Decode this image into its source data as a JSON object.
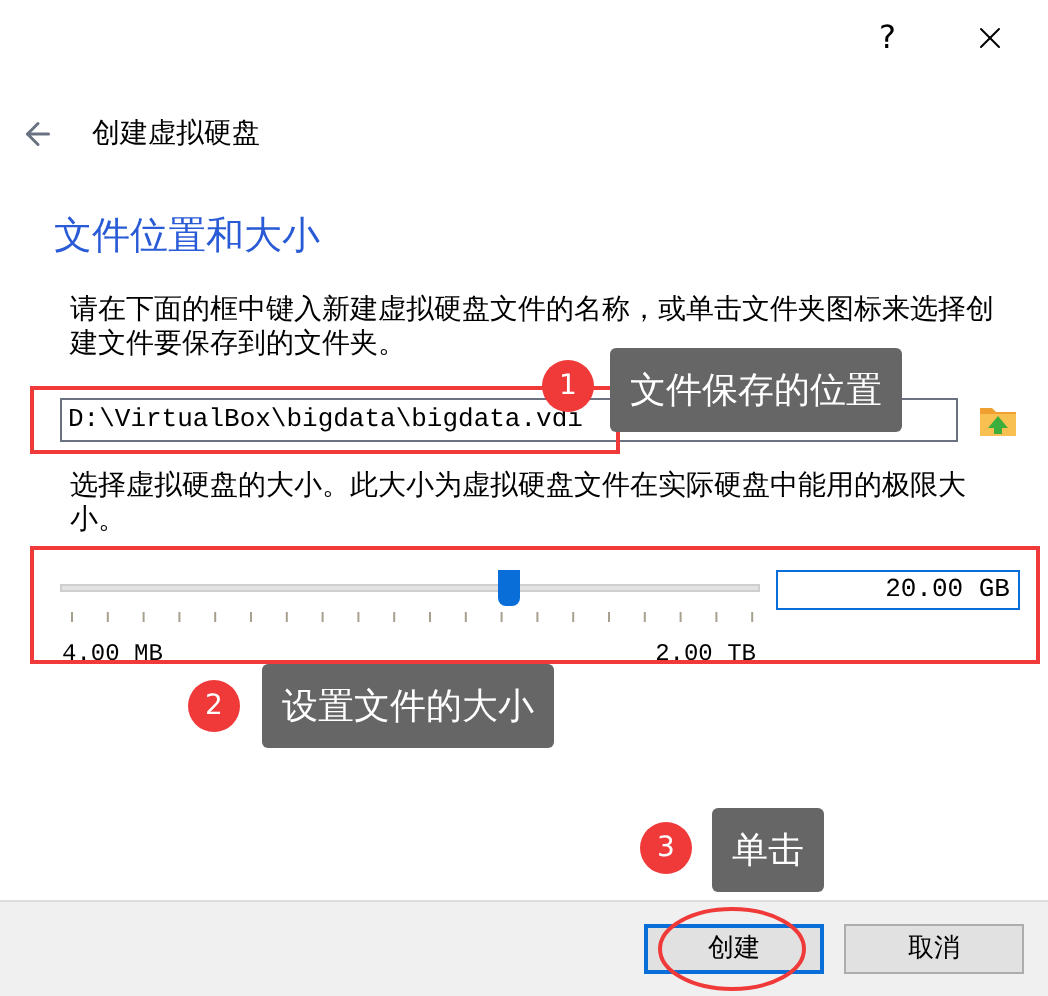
{
  "window": {
    "help": "?"
  },
  "header": {
    "title": "创建虚拟硬盘"
  },
  "section_title": "文件位置和大小",
  "location": {
    "description": "请在下面的框中键入新建虚拟硬盘文件的名称，或单击文件夹图标来选择创建文件要保存到的文件夹。",
    "value": "D:\\VirtualBox\\bigdata\\bigdata.vdi"
  },
  "size": {
    "description": "选择虚拟硬盘的大小。此大小为虚拟硬盘文件在实际硬盘中能用的极限大小。",
    "level": 0.64,
    "value": "20.00 GB",
    "min_label": "4.00 MB",
    "max_label": "2.00 TB"
  },
  "buttons": [
    {
      "label": "创建",
      "default": true
    },
    {
      "label": "取消",
      "default": false
    }
  ],
  "annotations": [
    {
      "number": "1",
      "text": "文件保存的位置"
    },
    {
      "number": "2",
      "text": "设置文件的大小"
    },
    {
      "number": "3",
      "text": "单击"
    }
  ]
}
